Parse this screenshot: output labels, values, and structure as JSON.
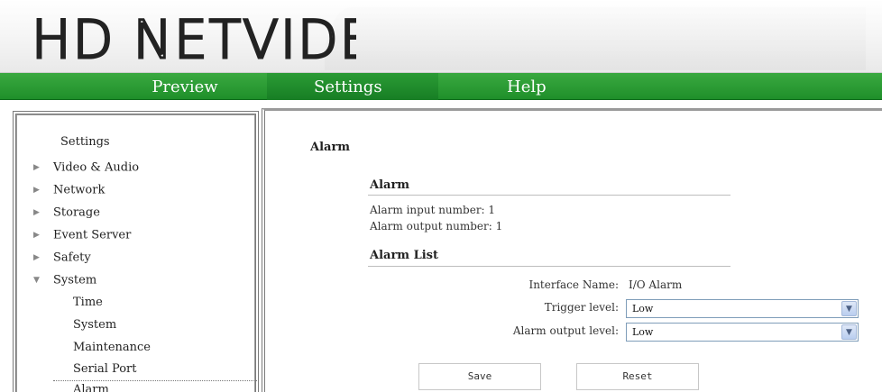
{
  "header": {
    "logo_text": "HD NETVIDEO"
  },
  "nav": {
    "preview": "Preview",
    "settings": "Settings",
    "help": "Help"
  },
  "sidebar": {
    "title": "Settings",
    "items": [
      {
        "label": "Video & Audio",
        "expanded": false
      },
      {
        "label": "Network",
        "expanded": false
      },
      {
        "label": "Storage",
        "expanded": false
      },
      {
        "label": "Event Server",
        "expanded": false
      },
      {
        "label": "Safety",
        "expanded": false
      },
      {
        "label": "System",
        "expanded": true
      }
    ],
    "subitems": [
      "Time",
      "System",
      "Maintenance",
      "Serial Port",
      "Alarm"
    ],
    "active_subitem": "Alarm"
  },
  "main": {
    "page_title": "Alarm",
    "alarm_section": {
      "title": "Alarm",
      "input_number": "Alarm input number:  1",
      "output_number": "Alarm output number:  1"
    },
    "list_section": {
      "title": "Alarm List",
      "interface_name_label": "Interface Name:",
      "interface_name_value": "I/O Alarm",
      "trigger_level_label": "Trigger level:",
      "trigger_level_value": "Low",
      "output_level_label": "Alarm output level:",
      "output_level_value": "Low"
    },
    "buttons": {
      "save": "Save",
      "reset": "Reset"
    }
  },
  "colors": {
    "nav_green": "#2b9b35",
    "text": "#222222"
  }
}
